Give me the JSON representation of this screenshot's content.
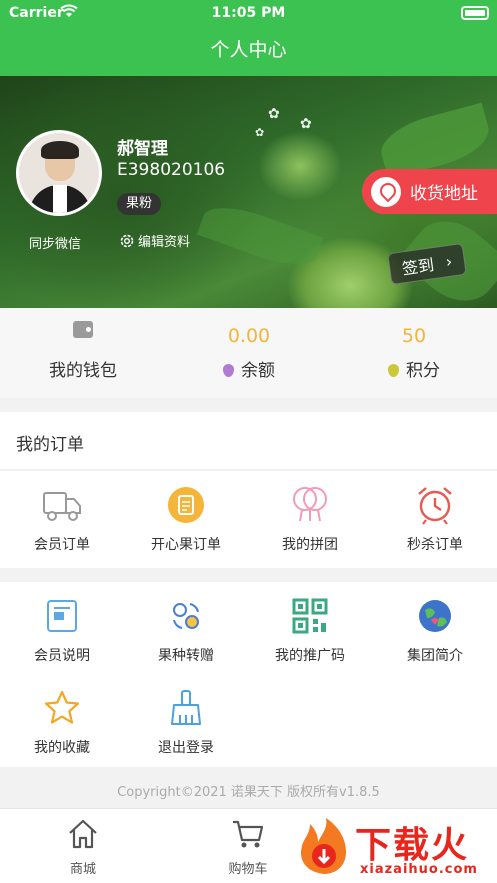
{
  "status_bar": {
    "carrier": "Carrier",
    "time": "11:05 PM"
  },
  "nav": {
    "title": "个人中心"
  },
  "profile": {
    "name": "郝智理",
    "id": "E398020106",
    "badge": "果粉",
    "sync_label": "同步微信",
    "edit_label": "编辑资料",
    "address_label": "收货地址",
    "checkin_label": "签到"
  },
  "wallet": {
    "wallet_label": "我的钱包",
    "balance_value": "0.00",
    "balance_label": "余额",
    "points_value": "50",
    "points_label": "积分"
  },
  "orders": {
    "title": "我的订单",
    "items": [
      {
        "label": "会员订单",
        "icon": "truck-icon"
      },
      {
        "label": "开心果订单",
        "icon": "clipboard-icon"
      },
      {
        "label": "我的拼团",
        "icon": "group-icon"
      },
      {
        "label": "秒杀订单",
        "icon": "alarm-clock-icon"
      }
    ]
  },
  "tools": {
    "items": [
      {
        "label": "会员说明",
        "icon": "member-card-icon"
      },
      {
        "label": "果种转赠",
        "icon": "transfer-icon"
      },
      {
        "label": "我的推广码",
        "icon": "qr-code-icon"
      },
      {
        "label": "集团简介",
        "icon": "globe-icon"
      },
      {
        "label": "我的收藏",
        "icon": "star-icon"
      },
      {
        "label": "退出登录",
        "icon": "broom-icon"
      }
    ]
  },
  "footer": {
    "copyright": "Copyright©2021 诺果天下 版权所有v1.8.5"
  },
  "tabbar": {
    "items": [
      {
        "label": "商城",
        "icon": "home-icon"
      },
      {
        "label": "购物车",
        "icon": "cart-icon"
      }
    ]
  },
  "watermark": {
    "main": "下载火",
    "sub": "xiazaihuo.com"
  },
  "colors": {
    "brand_green": "#3cc250",
    "accent_red": "#f0444c",
    "value_orange": "#f5b53a"
  }
}
